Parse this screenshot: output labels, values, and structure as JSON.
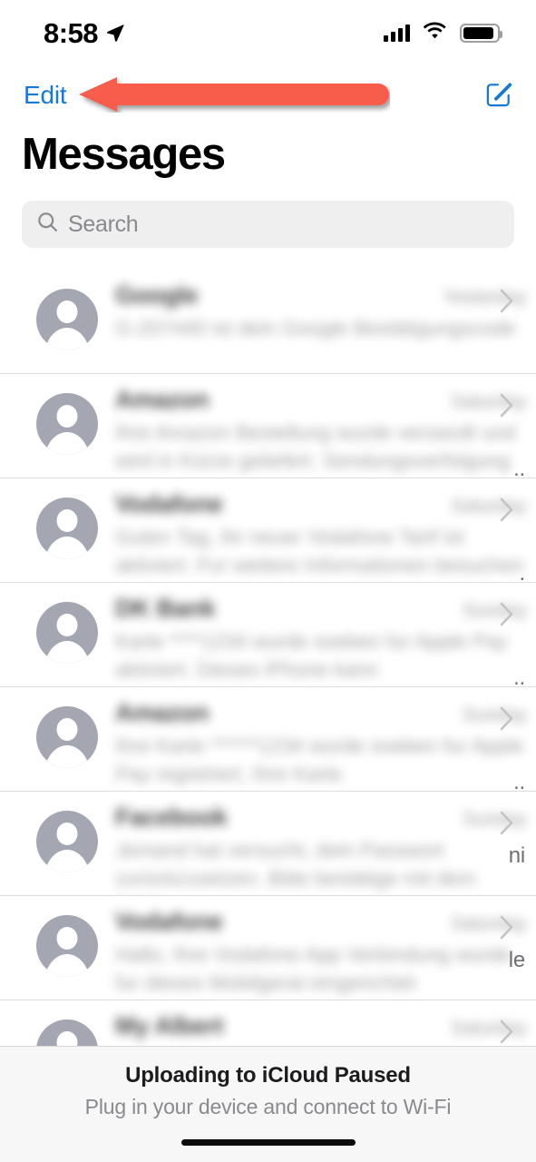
{
  "status_bar": {
    "time": "8:58",
    "location_icon": "location-arrow-icon",
    "cellular_icon": "cellular-signal-icon",
    "wifi_icon": "wifi-icon",
    "battery_icon": "battery-full-icon"
  },
  "nav_bar": {
    "edit_label": "Edit",
    "edit_color": "#1579D8",
    "compose_icon": "compose-new-message-icon",
    "compose_color": "#1579D8"
  },
  "header": {
    "title": "Messages"
  },
  "search": {
    "placeholder": "Search",
    "icon": "search-icon",
    "background": "#EFEFF0"
  },
  "annotation": {
    "type": "left-pointing-arrow",
    "color": "#F85C4C",
    "points_to": "Edit"
  },
  "conversations": [
    {
      "avatar_icon": "default-contact-avatar-icon",
      "name": "Google",
      "date": "Yesterday",
      "preview": "G-207440 ist dein Google Bestätigungscode",
      "chevron_icon": "chevron-right-icon",
      "edge_fragment": ""
    },
    {
      "avatar_icon": "default-contact-avatar-icon",
      "name": "Amazon",
      "date": "Saturday",
      "preview": "Ihre Amazon Bestellung wurde versandt und wird in Kürze geliefert. Sendungsverfolgung",
      "chevron_icon": "chevron-right-icon",
      "edge_fragment": ".."
    },
    {
      "avatar_icon": "default-contact-avatar-icon",
      "name": "Vodafone",
      "date": "Saturday",
      "preview": "Guten Tag, Ihr neuer Vodafone Tarif ist aktiviert. Fur weitere Informationen besuchen",
      "chevron_icon": "chevron-right-icon",
      "edge_fragment": "."
    },
    {
      "avatar_icon": "default-contact-avatar-icon",
      "name": "DK Bank",
      "date": "Sunday",
      "preview": "Karte ****1234 wurde soeben fur Apple Pay aktiviert. Dieses iPhone kann",
      "chevron_icon": "chevron-right-icon",
      "edge_fragment": ".."
    },
    {
      "avatar_icon": "default-contact-avatar-icon",
      "name": "Amazon",
      "date": "Sunday",
      "preview": "Ihre Karte ******1234 wurde soeben fur Apple Pay registriert, Ihre Karte",
      "chevron_icon": "chevron-right-icon",
      "edge_fragment": ".."
    },
    {
      "avatar_icon": "default-contact-avatar-icon",
      "name": "Facebook",
      "date": "Sunday",
      "preview": "Jemand hat versucht, dein Passwort zurückzusetzen. Bitte bestätige mit dem Code",
      "chevron_icon": "chevron-right-icon",
      "edge_fragment": "ni"
    },
    {
      "avatar_icon": "default-contact-avatar-icon",
      "name": "Vodafone",
      "date": "Saturday",
      "preview": "Hallo, Ihre Vodafone App Verbindung wurde fur dieses Mobilgerat eingerichtet",
      "chevron_icon": "chevron-right-icon",
      "edge_fragment": "le"
    },
    {
      "avatar_icon": "default-contact-avatar-icon",
      "name": "My Albert",
      "date": "Saturday",
      "preview": "",
      "chevron_icon": "chevron-right-icon",
      "edge_fragment": ""
    }
  ],
  "status_banner": {
    "title": "Uploading to iCloud Paused",
    "subtitle": "Plug in your device and connect to Wi-Fi"
  },
  "home_indicator": {
    "name": "home-indicator"
  }
}
